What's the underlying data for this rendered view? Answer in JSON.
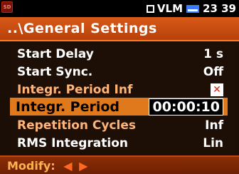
{
  "status": {
    "mode": "VLM",
    "time": "23 39"
  },
  "header": {
    "title": "..\\General Settings"
  },
  "settings": [
    {
      "label": "Start Delay",
      "value": "1 s"
    },
    {
      "label": "Start Sync.",
      "value": "Off"
    },
    {
      "label": "Integr. Period Inf",
      "value": ""
    },
    {
      "label": "Integr. Period",
      "value": "00:00:10"
    },
    {
      "label": "Repetition Cycles",
      "value": "Inf"
    },
    {
      "label": "RMS Integration",
      "value": "Lin"
    }
  ],
  "footer": {
    "label": "Modify:",
    "arrows": "◀ ▶"
  },
  "icons": {
    "sd_card": "SD",
    "checkbox_mark": "✕",
    "battery": "battery-icon"
  },
  "colors": {
    "accent": "#e0781c",
    "header": "#c84c10",
    "checkbox_x": "#e02010"
  }
}
